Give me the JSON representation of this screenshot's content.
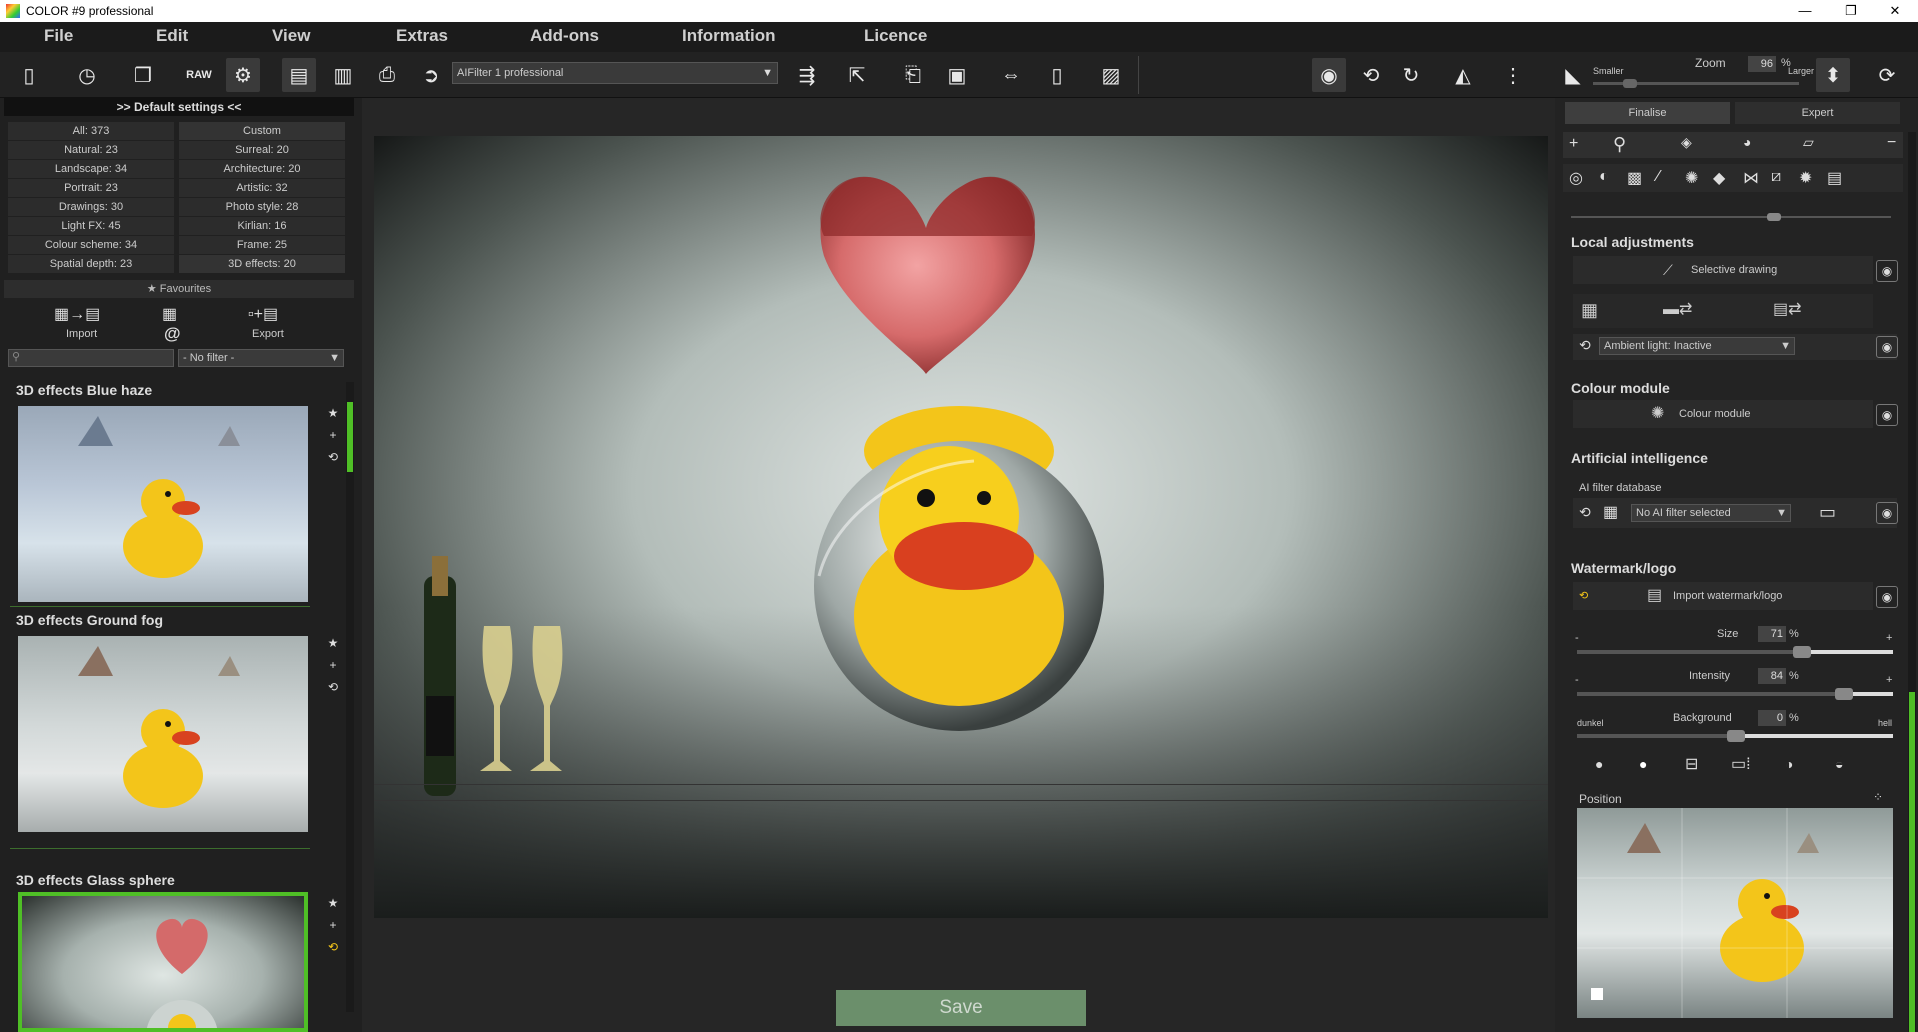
{
  "window": {
    "title": "COLOR #9 professional",
    "minimize": "—",
    "restore": "❐",
    "close": "✕"
  },
  "menu": [
    "File",
    "Edit",
    "View",
    "Extras",
    "Add-ons",
    "Information",
    "Licence"
  ],
  "toolbar": {
    "filter_select": "AIFilter 1 professional",
    "zoom_label": "Zoom",
    "zoom_value": "96",
    "zoom_unit": "%",
    "smaller": "Smaller",
    "larger": "Larger"
  },
  "left": {
    "header": ">> Default settings <<",
    "categories": [
      [
        "All: 373",
        "Custom"
      ],
      [
        "Natural: 23",
        "Surreal: 20"
      ],
      [
        "Landscape: 34",
        "Architecture: 20"
      ],
      [
        "Portrait: 23",
        "Artistic: 32"
      ],
      [
        "Drawings: 30",
        "Photo style: 28"
      ],
      [
        "Light FX: 45",
        "Kirlian: 16"
      ],
      [
        "Colour scheme: 34",
        "Frame: 25"
      ],
      [
        "Spatial depth: 23",
        "3D effects: 20"
      ]
    ],
    "favourites": "Favourites",
    "import": "Import",
    "export": "Export",
    "filter": "- No filter -",
    "presets": [
      {
        "title": "3D effects Blue haze"
      },
      {
        "title": "3D effects Ground fog"
      },
      {
        "title": "3D effects Glass sphere"
      }
    ]
  },
  "center": {
    "save": "Save"
  },
  "right": {
    "tab_finalise": "Finalise",
    "tab_expert": "Expert",
    "local_adjustments": "Local adjustments",
    "selective_drawing": "Selective drawing",
    "ambient_light": "Ambient light: Inactive",
    "colour_module_title": "Colour module",
    "colour_module": "Colour module",
    "ai_title": "Artificial intelligence",
    "ai_db": "AI filter database",
    "ai_filter": "No AI filter selected",
    "watermark_title": "Watermark/logo",
    "import_watermark": "Import watermark/logo",
    "size_label": "Size",
    "size_value": "71",
    "intensity_label": "Intensity",
    "intensity_value": "84",
    "background_label": "Background",
    "background_value": "0",
    "percent": "%",
    "minus": "-",
    "plus": "+",
    "dark": "dunkel",
    "bright": "hell",
    "position": "Position"
  }
}
